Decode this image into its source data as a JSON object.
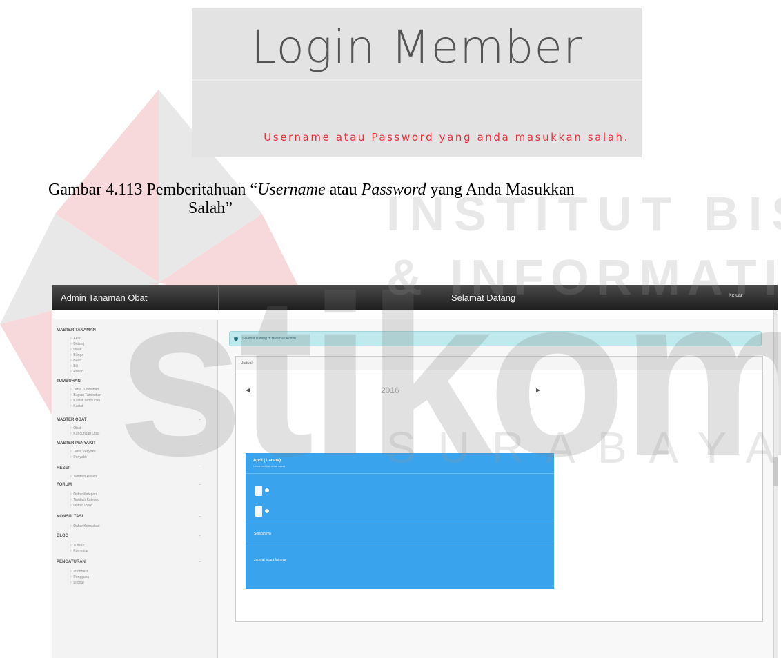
{
  "login": {
    "title": "Login Member",
    "error": "Username atau Password yang anda masukkan salah."
  },
  "caption": {
    "prefix": "Gambar 4.113 Pemberitahuan “",
    "word1": "Username",
    "middle1": " atau ",
    "word2": "Password",
    "middle2": " yang Anda Masukkan",
    "line2": "Salah”"
  },
  "watermark": {
    "institut": "INSTITUT BISNIS",
    "informatika": "& INFORMATIKA",
    "stikom": "stikom",
    "surabaya": "SURABAYA",
    "logo_colors": [
      "#f1b9bf",
      "#cfcfcf"
    ]
  },
  "admin": {
    "brand": "Admin Tanaman Obat",
    "welcome": "Selamat Datang",
    "logout": "Keluar",
    "panel_label": "Jadwal",
    "year": "2016",
    "prev_icon": "chevron-left-icon",
    "next_icon": "chevron-right-icon",
    "colors": {
      "topbar": "#2a2a2a",
      "alert": "#bfe9ec",
      "month": "#3aa3ed"
    },
    "alert_text": "Selamat Datang di Halaman Admin",
    "month": {
      "name": "April (1 acara)",
      "sub": "Untuk melihat detail acara"
    },
    "month_links": [
      "Selebihnya",
      "Jadwal acara lainnya"
    ],
    "sidebar": [
      {
        "title": "MASTER TANAMAN",
        "toggle": "–",
        "items": [
          "Akar",
          "Batang",
          "Daun",
          "Bunga",
          "Buah",
          "Biji",
          "Pohon"
        ]
      },
      {
        "title": "TUMBUHAN",
        "toggle": "–",
        "items": [
          "Jenis Tumbuhan",
          "Bagian Tumbuhan",
          "Kasiat Tumbuhan",
          "Kasiat"
        ]
      },
      {
        "title": "MASTER OBAT",
        "toggle": "–",
        "items": [
          "Obat",
          "Kandungan Obat"
        ]
      },
      {
        "title": "MASTER PENYAKIT",
        "toggle": "–",
        "items": [
          "Jenis Penyakit",
          "Penyakit"
        ]
      },
      {
        "title": "RESEP",
        "toggle": "–",
        "items": [
          "Tambah Resep"
        ]
      },
      {
        "title": "FORUM",
        "toggle": "–",
        "items": [
          "Daftar Kategori",
          "Tambah Kategori",
          "Daftar Topik"
        ]
      },
      {
        "title": "KONSULTASI",
        "toggle": "–",
        "items": [
          "Daftar Konsultasi"
        ]
      },
      {
        "title": "BLOG",
        "toggle": "–",
        "items": [
          "Tulisan",
          "Komentar"
        ]
      },
      {
        "title": "PENGATURAN",
        "toggle": "–",
        "items": [
          "Informasi",
          "Pengguna",
          "Logout"
        ]
      }
    ]
  }
}
